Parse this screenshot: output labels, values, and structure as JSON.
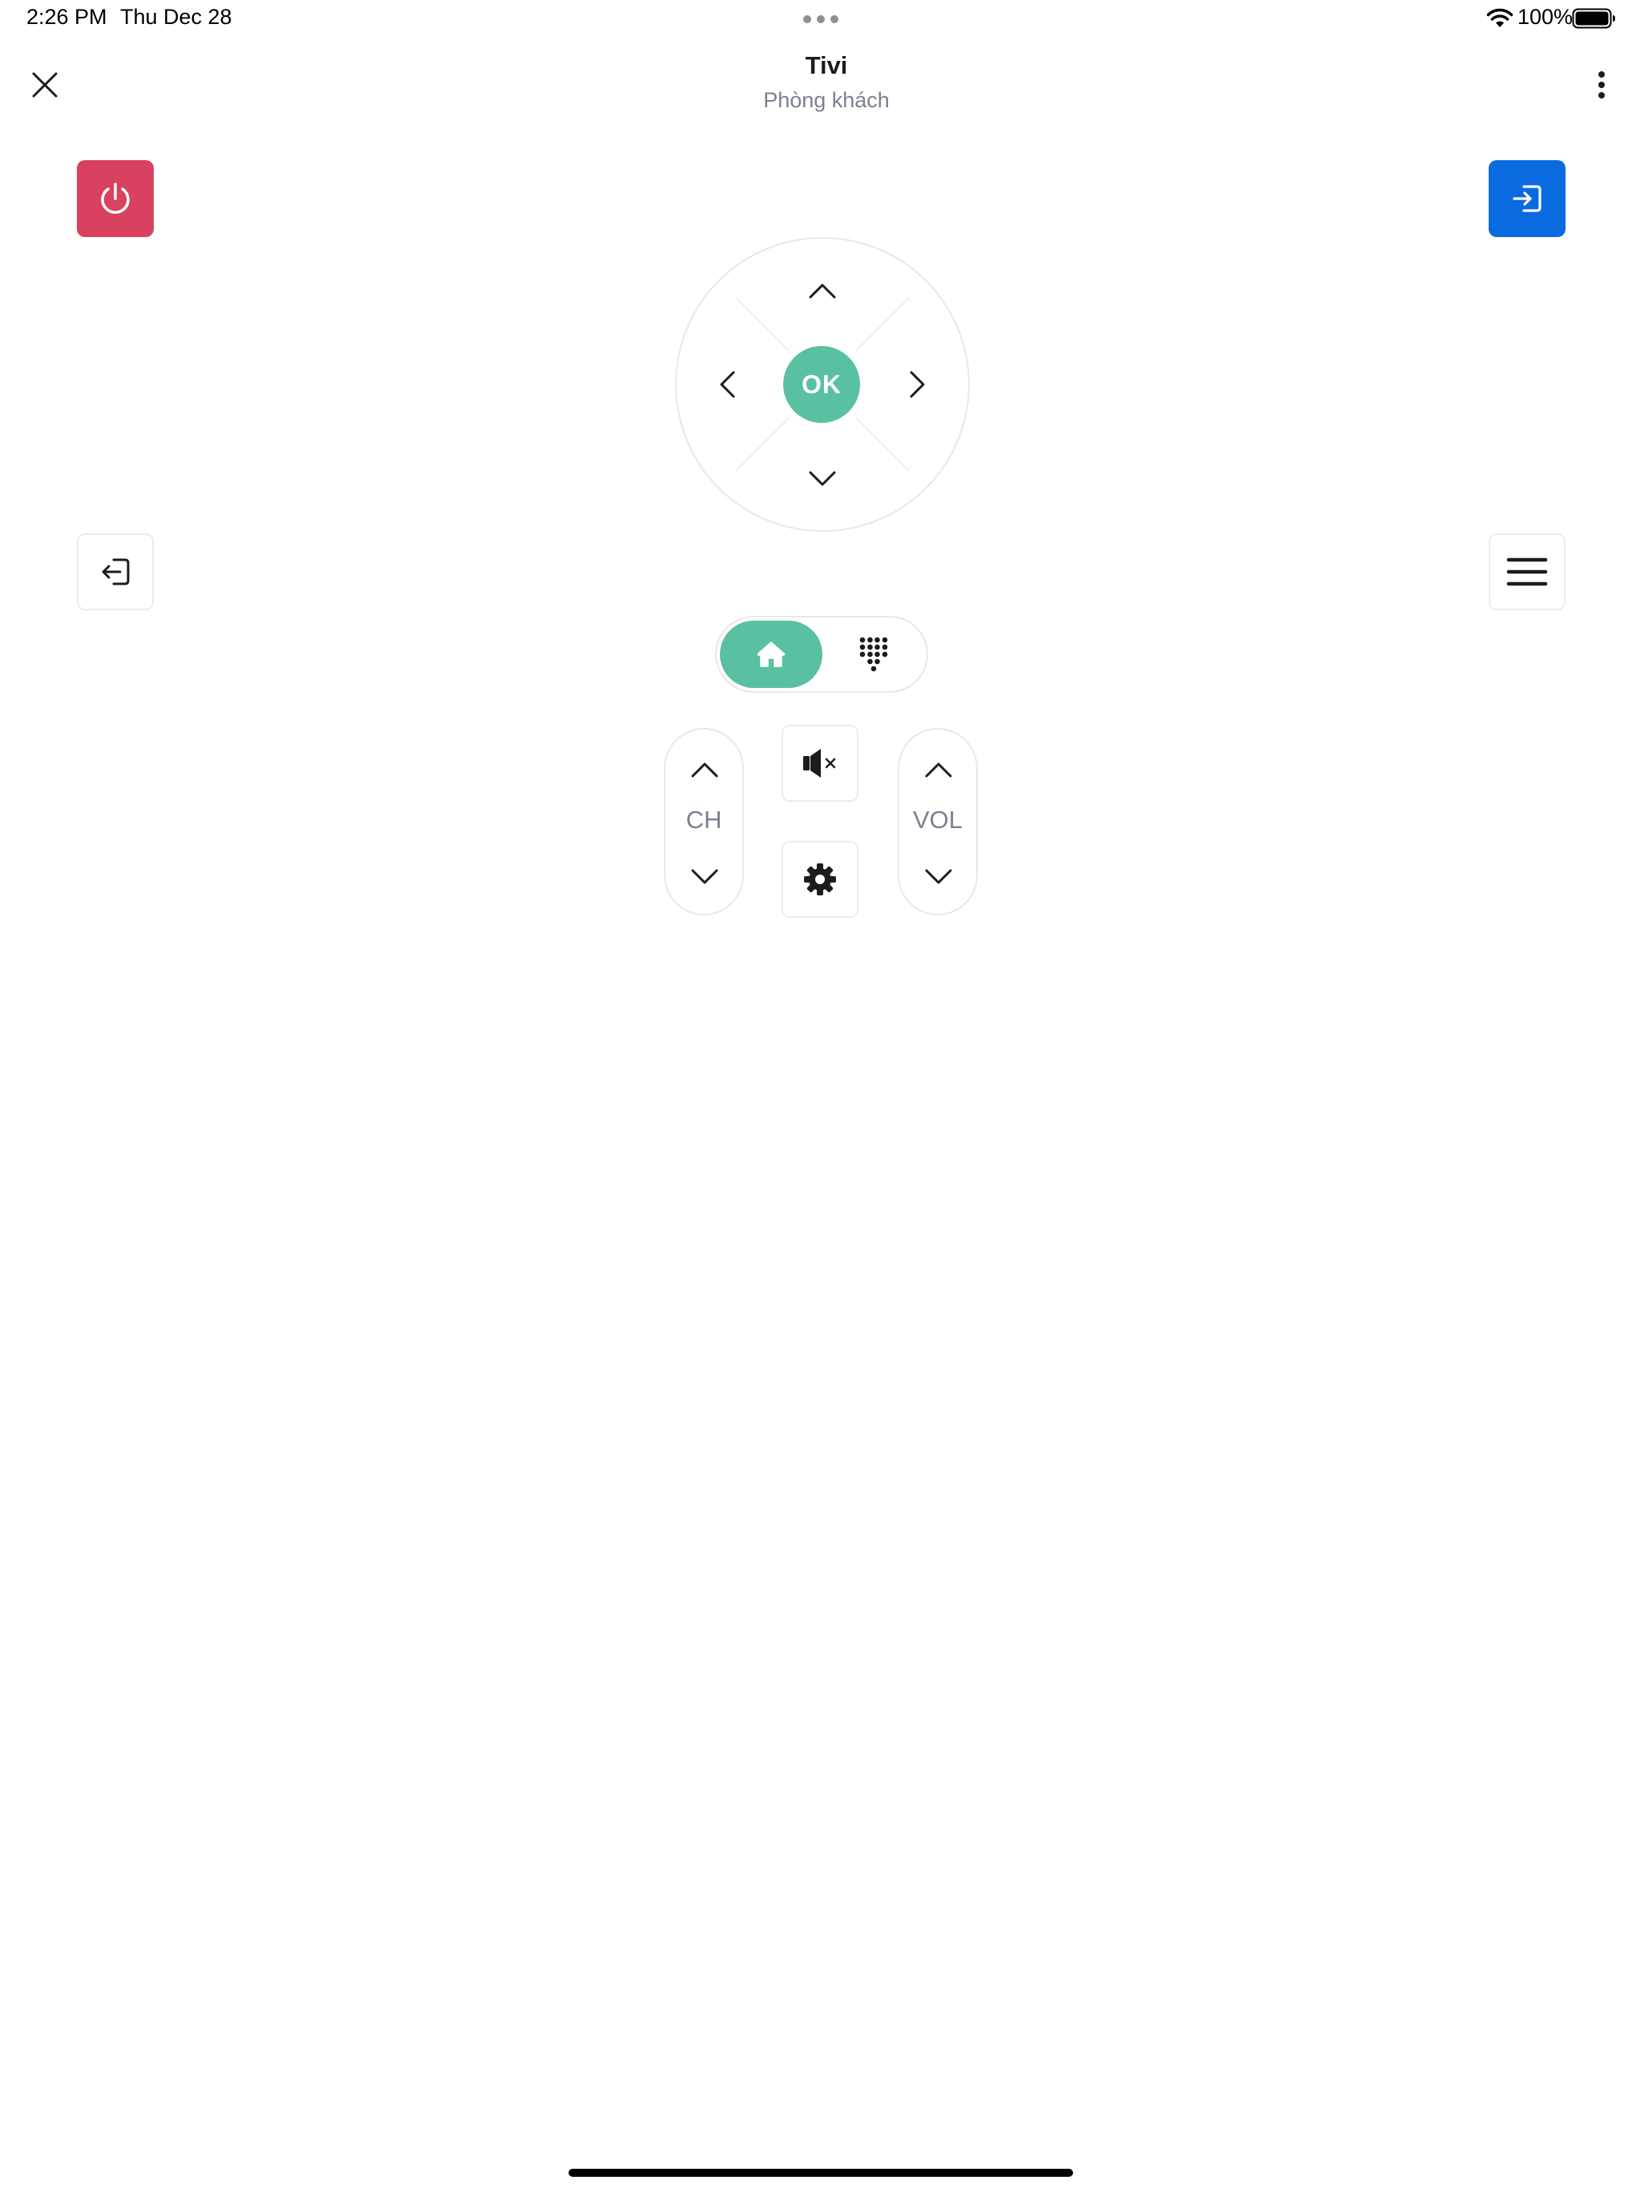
{
  "status_bar": {
    "time": "2:26 PM",
    "date": "Thu Dec 28",
    "battery": "100%"
  },
  "header": {
    "title": "Tivi",
    "subtitle": "Phòng khách",
    "close_icon": "close-icon",
    "more_icon": "more-vertical-icon"
  },
  "buttons": {
    "power": {
      "icon": "power-icon",
      "color": "#d8415f"
    },
    "input": {
      "icon": "input-icon",
      "color": "#0a6ae0"
    },
    "back": {
      "icon": "exit-icon"
    },
    "menu": {
      "icon": "hamburger-menu-icon"
    }
  },
  "dpad": {
    "ok_label": "OK",
    "ok_color": "#5ac0a2"
  },
  "toggle": {
    "selected": "home",
    "options": [
      "home",
      "keypad"
    ]
  },
  "rockers": {
    "ch_label": "CH",
    "vol_label": "VOL"
  },
  "center_buttons": {
    "mute": {
      "icon": "mute-icon"
    },
    "settings": {
      "icon": "settings-gear-icon"
    }
  }
}
